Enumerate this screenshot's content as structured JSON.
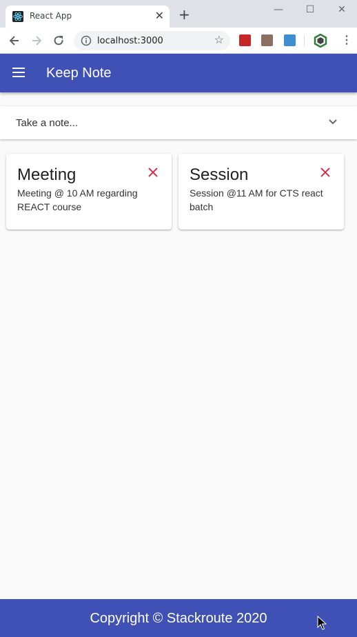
{
  "browser": {
    "tab_title": "React App",
    "tab_close": "✕",
    "new_tab": "+",
    "url": "localhost:3000",
    "window_controls": {
      "minimize": "—",
      "maximize": "☐",
      "close": "✕"
    }
  },
  "app": {
    "title": "Keep Note",
    "brand_color": "#3f51b5"
  },
  "note_input": {
    "placeholder": "Take a note..."
  },
  "notes": [
    {
      "title": "Meeting",
      "body": "Meeting @ 10 AM regarding REACT course"
    },
    {
      "title": "Session",
      "body": "Session @11 AM for CTS react batch"
    }
  ],
  "footer": {
    "text": "Copyright © Stackroute 2020"
  },
  "colors": {
    "delete": "#d32f4f"
  }
}
